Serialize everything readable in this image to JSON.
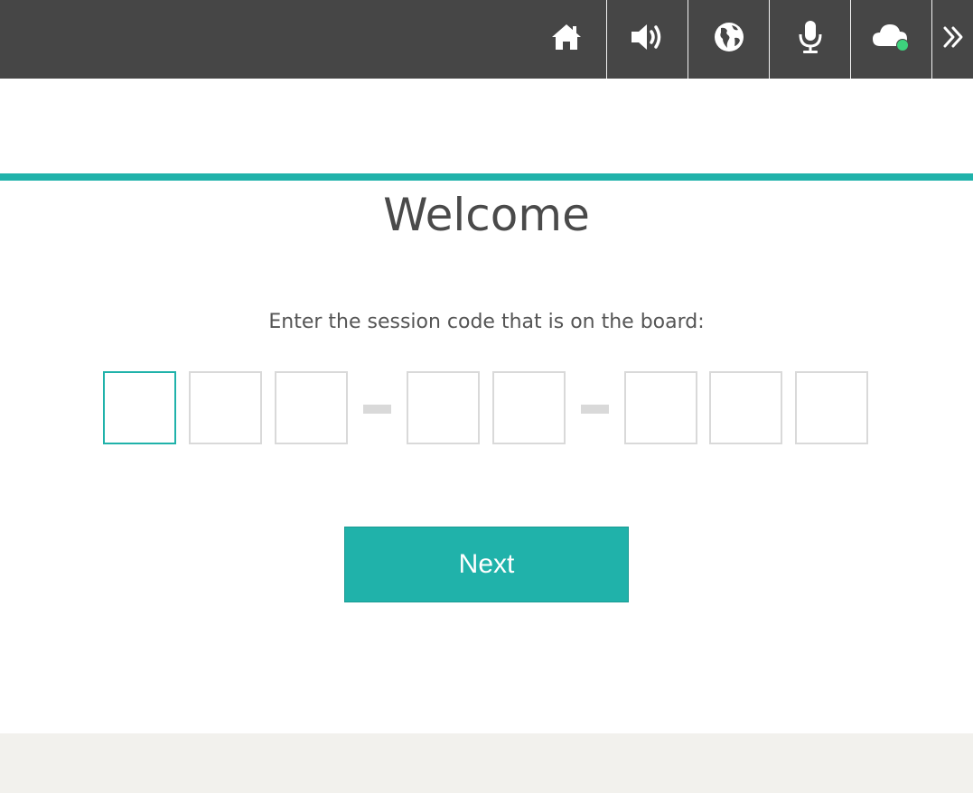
{
  "toolbar": {
    "background_color": "#464646",
    "buttons": [
      {
        "name": "home",
        "icon": "home-icon"
      },
      {
        "name": "audio",
        "icon": "speaker-icon"
      },
      {
        "name": "language",
        "icon": "globe-icon"
      },
      {
        "name": "microphone",
        "icon": "microphone-icon"
      },
      {
        "name": "connection",
        "icon": "cloud-icon",
        "status_color": "#3dd17c"
      },
      {
        "name": "expand",
        "icon": "double-chevron-right-icon"
      }
    ]
  },
  "main": {
    "title": "Welcome",
    "prompt": "Enter the session code that is on the board:",
    "code": {
      "groups": [
        3,
        2,
        3
      ],
      "separator": "-",
      "values": [
        "",
        "",
        "",
        "",
        "",
        "",
        "",
        ""
      ],
      "focused_index": 0
    },
    "next_label": "Next"
  },
  "colors": {
    "accent": "#20b2aa",
    "box_border": "#d9d9d9",
    "footer": "#f2f1ed",
    "text": "#4a4a4a"
  }
}
